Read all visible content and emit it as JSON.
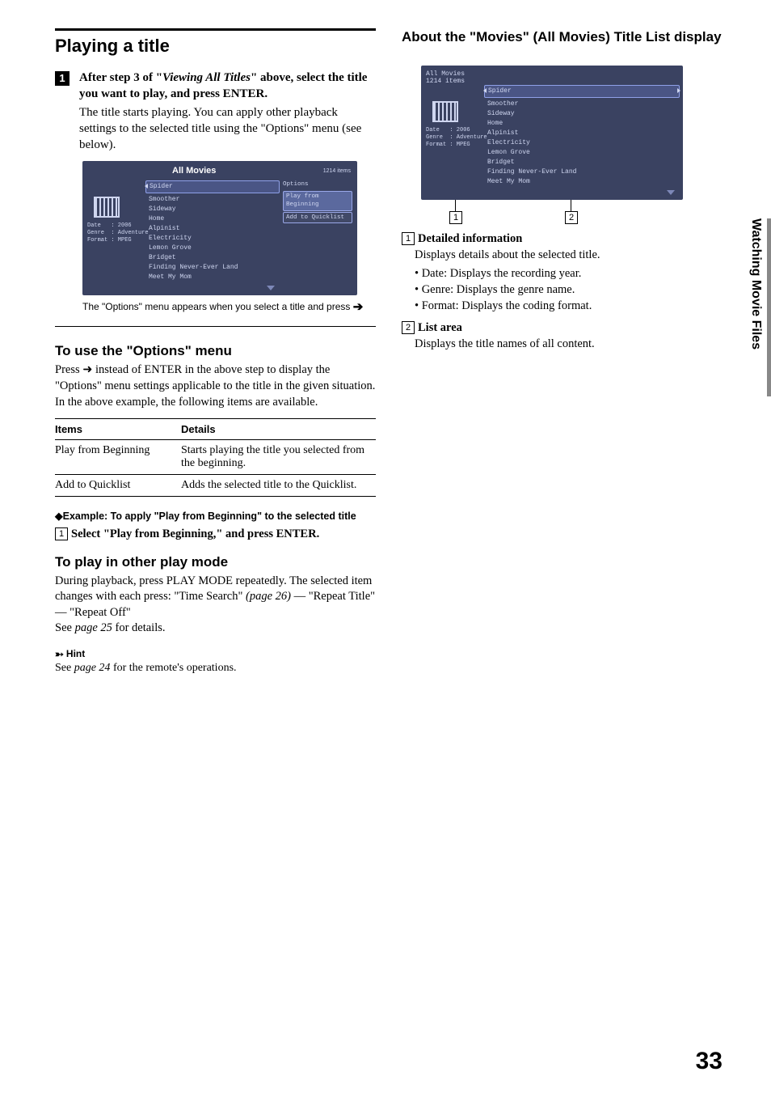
{
  "side_tab": "Watching Movie Files",
  "page_number": "33",
  "left": {
    "title": "Playing a title",
    "step1_num": "1",
    "step1_a": "After step 3 of \"",
    "step1_b": "Viewing All Titles",
    "step1_c": "\" above, select the title you want to play, and press ENTER.",
    "step1_desc": "The title starts playing. You can apply other playback settings to the selected title using the \"Options\" menu (see below).",
    "caption": "The \"Options\" menu appears when you select a title and press ",
    "options_h": "To use the \"Options\" menu",
    "options_p": "Press ➜ instead of ENTER in the above step to display the \"Options\" menu settings applicable to the title in the given situation. In the above example, the following items are available.",
    "th1": "Items",
    "th2": "Details",
    "row1a": "Play from Beginning",
    "row1b": "Starts playing the title you selected from the beginning.",
    "row2a": "Add to Quicklist",
    "row2b": "Adds the selected title to the Quicklist.",
    "example_line": "◆Example: To apply \"Play from Beginning\" to the selected title",
    "example_step": "Select \"Play from Beginning,\" and press ENTER.",
    "playmode_h": "To play in other play mode",
    "playmode_p1": "During playback, press PLAY MODE repeatedly. The selected item changes with each press: \"Time Search\" ",
    "playmode_ref1": "(page 26)",
    "playmode_p2": " — \"Repeat Title\" — \"Repeat Off\"",
    "playmode_see_a": "See ",
    "playmode_see_b": "page 25",
    "playmode_see_c": " for details.",
    "hint_label": "Hint",
    "hint_a": "See ",
    "hint_b": "page 24",
    "hint_c": " for the remote's operations."
  },
  "right": {
    "title": "About the \"Movies\" (All Movies) Title List display",
    "d1_h": "Detailed information",
    "d1_p": "Displays details about the selected title.",
    "d1_b1": "Date: Displays the recording year.",
    "d1_b2": "Genre: Displays the genre name.",
    "d1_b3": "Format: Displays the coding format.",
    "d2_h": "List area",
    "d2_p": "Displays the title names of all content."
  },
  "shot": {
    "title": "All Movies",
    "count": "1214 items",
    "side_date": "Date   : 2006",
    "side_genre": "Genre  : Adventure",
    "side_format": "Format : MPEG",
    "items": [
      "Spider",
      "Smoother",
      "Sideway",
      "Home",
      "Alpinist",
      "Electricity",
      "Lemon Grove",
      "Bridget",
      "Finding Never-Ever Land",
      "Meet My Mom"
    ],
    "opt_label": "Options",
    "opt1": "Play from Beginning",
    "opt2": "Add to Quicklist"
  }
}
